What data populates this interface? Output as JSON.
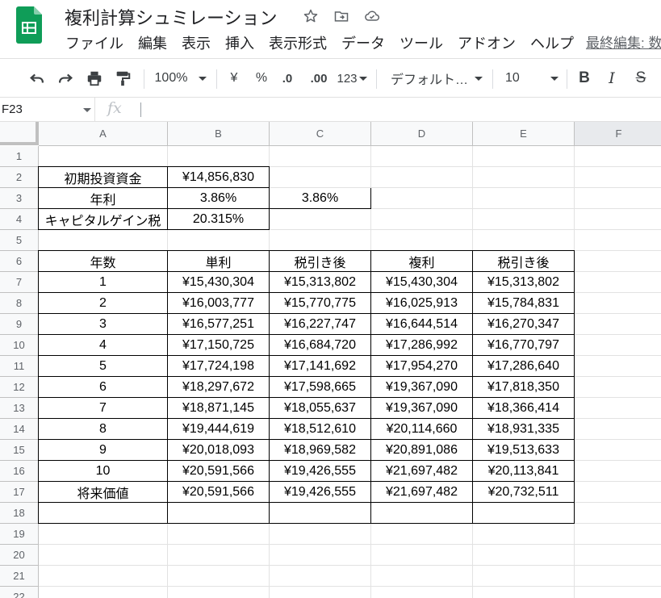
{
  "app": {
    "doc_title": "複利計算シュミレーション",
    "menu": [
      "ファイル",
      "編集",
      "表示",
      "挿入",
      "表示形式",
      "データ",
      "ツール",
      "アドオン",
      "ヘルプ"
    ],
    "last_edit": "最終編集: 数"
  },
  "toolbar": {
    "zoom": "100%",
    "currency": "¥",
    "percent": "%",
    "decimal_decrease": ".0",
    "decimal_increase": ".00",
    "more_formats": "123",
    "font": "デフォルト…",
    "font_size": "10",
    "bold": "B",
    "italic": "I",
    "strikethrough": "S"
  },
  "formula_bar": {
    "cell_ref": "F23",
    "fx": "fx",
    "formula": ""
  },
  "grid": {
    "columns": [
      "A",
      "B",
      "C",
      "D",
      "E",
      "F"
    ],
    "rows": [
      "1",
      "2",
      "3",
      "4",
      "5",
      "6",
      "7",
      "8",
      "9",
      "10",
      "11",
      "12",
      "13",
      "14",
      "15",
      "16",
      "17",
      "18",
      "19",
      "20",
      "21",
      "22"
    ],
    "cells": {
      "A2": "初期投資資金",
      "B2": "¥14,856,830",
      "A3": "年利",
      "B3": "3.86%",
      "C3": "3.86%",
      "A4": "キャピタルゲイン税",
      "B4": "20.315%",
      "A6": "年数",
      "B6": "単利",
      "C6": "税引き後",
      "D6": "複利",
      "E6": "税引き後",
      "A7": "1",
      "B7": "¥15,430,304",
      "C7": "¥15,313,802",
      "D7": "¥15,430,304",
      "E7": "¥15,313,802",
      "A8": "2",
      "B8": "¥16,003,777",
      "C8": "¥15,770,775",
      "D8": "¥16,025,913",
      "E8": "¥15,784,831",
      "A9": "3",
      "B9": "¥16,577,251",
      "C9": "¥16,227,747",
      "D9": "¥16,644,514",
      "E9": "¥16,270,347",
      "A10": "4",
      "B10": "¥17,150,725",
      "C10": "¥16,684,720",
      "D10": "¥17,286,992",
      "E10": "¥16,770,797",
      "A11": "5",
      "B11": "¥17,724,198",
      "C11": "¥17,141,692",
      "D11": "¥17,954,270",
      "E11": "¥17,286,640",
      "A12": "6",
      "B12": "¥18,297,672",
      "C12": "¥17,598,665",
      "D12": "¥19,367,090",
      "E12": "¥17,818,350",
      "A13": "7",
      "B13": "¥18,871,145",
      "C13": "¥18,055,637",
      "D13": "¥19,367,090",
      "E13": "¥18,366,414",
      "A14": "8",
      "B14": "¥19,444,619",
      "C14": "¥18,512,610",
      "D14": "¥20,114,660",
      "E14": "¥18,931,335",
      "A15": "9",
      "B15": "¥20,018,093",
      "C15": "¥18,969,582",
      "D15": "¥20,891,086",
      "E15": "¥19,513,633",
      "A16": "10",
      "B16": "¥20,591,566",
      "C16": "¥19,426,555",
      "D16": "¥21,697,482",
      "E16": "¥20,113,841",
      "A17": "将来価値",
      "B17": "¥20,591,566",
      "C17": "¥19,426,555",
      "D17": "¥21,697,482",
      "E17": "¥20,732,511"
    }
  },
  "colors": {
    "sheets_green": "#0f9d58",
    "header_bg": "#f8f9fa",
    "gridline": "#e2e2e2"
  }
}
